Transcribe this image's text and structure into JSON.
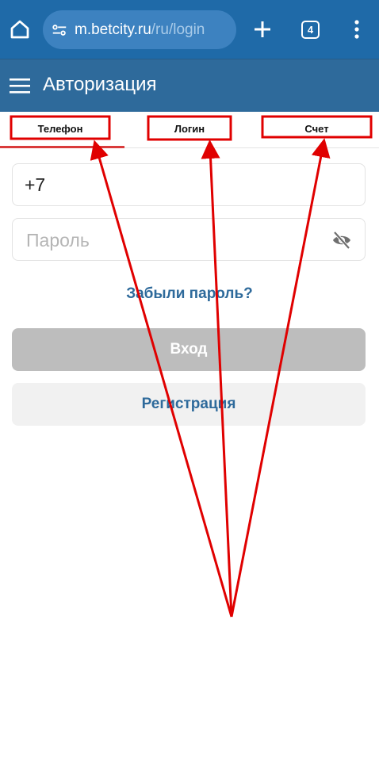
{
  "browser": {
    "url_domain": "m.betcity.ru",
    "url_path": "/ru/login",
    "tab_count": "4",
    "icons": {
      "home": "home-icon",
      "site_settings": "tune-icon",
      "new_tab": "plus-icon",
      "menu": "more-vert-icon"
    }
  },
  "header": {
    "title": "Авторизация",
    "menu_icon": "hamburger-icon"
  },
  "tabs": [
    {
      "label": "Телефон",
      "active": true
    },
    {
      "label": "Логин",
      "active": false
    },
    {
      "label": "Счет",
      "active": false
    }
  ],
  "form": {
    "phone_value": "+7",
    "password_placeholder": "Пароль",
    "password_visibility_icon": "eye-off-icon",
    "forgot_link": "Забыли пароль?",
    "login_button": "Вход",
    "register_button": "Регистрация"
  },
  "colors": {
    "browser_bar": "#1f6aa8",
    "header": "#2e6a9b",
    "accent_text": "#2e6a9b",
    "active_tab_underline": "#d93b3b",
    "annotation": "#e00000",
    "disabled_button": "#bdbdbd"
  }
}
